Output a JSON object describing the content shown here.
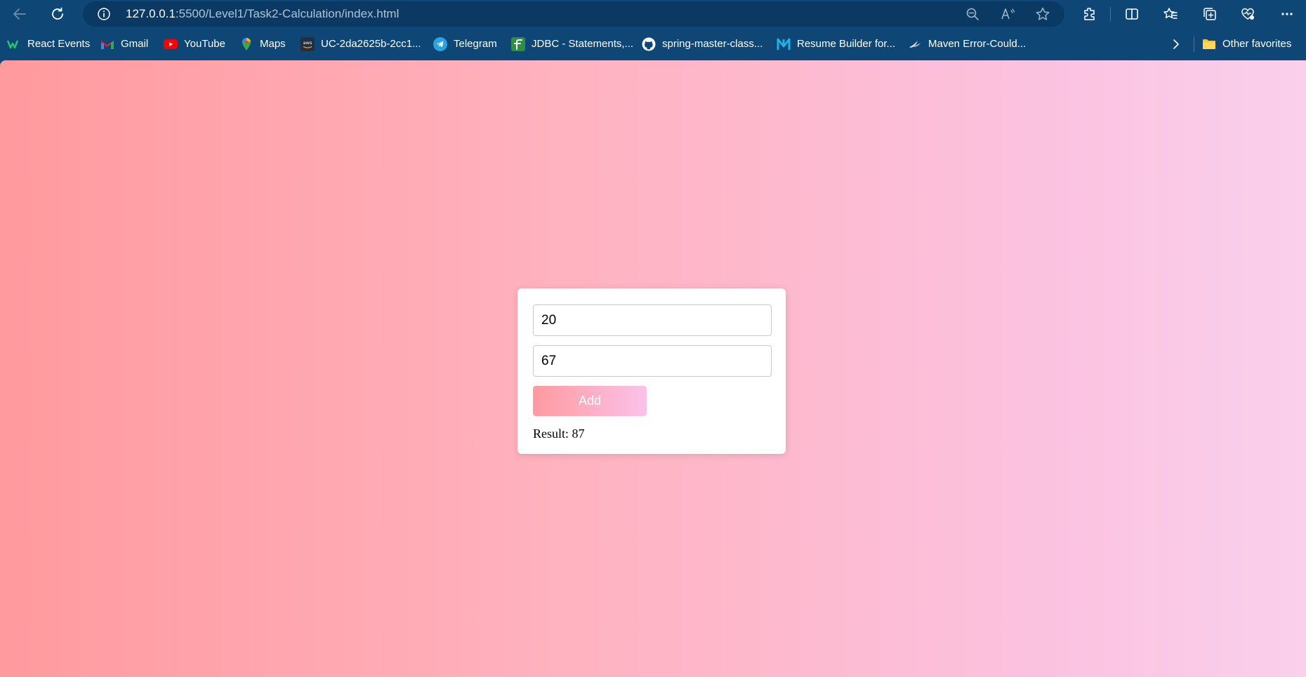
{
  "browser": {
    "url_host": "127.0.0.1",
    "url_rest": ":5500/Level1/Task2-Calculation/index.html",
    "icons": [
      "back-arrow-icon",
      "refresh-icon",
      "site-info-icon",
      "zoom-out-icon",
      "read-aloud-icon",
      "favorite-star-icon",
      "extensions-icon",
      "split-screen-icon",
      "favorites-icon",
      "collections-icon",
      "browser-essentials-icon",
      "more-options-icon"
    ]
  },
  "bookmarks": {
    "items": [
      {
        "label": "React Events",
        "icon": "react-events-icon"
      },
      {
        "label": "Gmail",
        "icon": "gmail-icon"
      },
      {
        "label": "YouTube",
        "icon": "youtube-icon"
      },
      {
        "label": "Maps",
        "icon": "maps-icon"
      },
      {
        "label": "UC-2da2625b-2cc1...",
        "icon": "aws-icon"
      },
      {
        "label": "Telegram",
        "icon": "telegram-icon"
      },
      {
        "label": "JDBC - Statements,...",
        "icon": "jdbc-icon"
      },
      {
        "label": "spring-master-class...",
        "icon": "github-icon"
      },
      {
        "label": "Resume Builder for...",
        "icon": "resume-builder-icon"
      },
      {
        "label": "Maven Error-Could...",
        "icon": "maven-icon"
      }
    ],
    "other_favorites": "Other favorites"
  },
  "calculator": {
    "first_value": "20",
    "second_value": "67",
    "add_label": "Add",
    "result_text": "Result: 87"
  },
  "colors": {
    "toolbar_bg": "#0e4675",
    "address_bar_bg": "#0a3a63",
    "page_gradient_start": "#ff9a9e",
    "page_gradient_end": "#fad0ec",
    "button_gradient_start": "#ff9a9e",
    "button_gradient_end": "#fbc2eb"
  }
}
